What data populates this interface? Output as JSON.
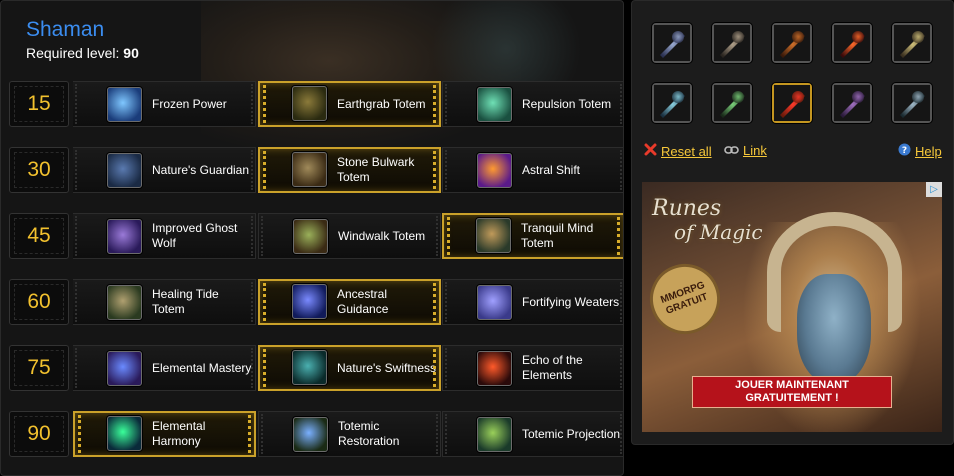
{
  "header": {
    "class_name": "Shaman",
    "required_level_label": "Required level:",
    "required_level_value": "90"
  },
  "tiers": [
    {
      "level": "15",
      "talents": [
        {
          "name": "Frozen Power",
          "icon": "frozen-power-icon",
          "selected": false,
          "colors": [
            "#7fc7ff",
            "#1a3c7a"
          ]
        },
        {
          "name": "Earthgrab Totem",
          "icon": "earthgrab-totem-icon",
          "selected": true,
          "colors": [
            "#8b7a3a",
            "#2a2a10"
          ]
        },
        {
          "name": "Repulsion Totem",
          "icon": "repulsion-totem-icon",
          "selected": false,
          "colors": [
            "#6fe0b5",
            "#1a5040"
          ]
        }
      ]
    },
    {
      "level": "30",
      "talents": [
        {
          "name": "Nature's Guardian",
          "icon": "natures-guardian-icon",
          "selected": false,
          "colors": [
            "#5a7ab0",
            "#1a2a44"
          ]
        },
        {
          "name": "Stone Bulwark Totem",
          "icon": "stone-bulwark-totem-icon",
          "selected": true,
          "colors": [
            "#a08a5a",
            "#3a2a14"
          ]
        },
        {
          "name": "Astral Shift",
          "icon": "astral-shift-icon",
          "selected": false,
          "colors": [
            "#ff9a30",
            "#5a1a8a"
          ]
        }
      ]
    },
    {
      "level": "45",
      "talents": [
        {
          "name": "Improved Ghost Wolf",
          "icon": "improved-ghost-wolf-icon",
          "selected": false,
          "colors": [
            "#9a7ad8",
            "#2a1a5a"
          ]
        },
        {
          "name": "Windwalk Totem",
          "icon": "windwalk-totem-icon",
          "selected": false,
          "colors": [
            "#9ab05a",
            "#3a2a14"
          ]
        },
        {
          "name": "Tranquil Mind Totem",
          "icon": "tranquil-mind-totem-icon",
          "selected": true,
          "colors": [
            "#c09a5a",
            "#2a3a2a"
          ]
        }
      ]
    },
    {
      "level": "60",
      "talents": [
        {
          "name": "Healing Tide Totem",
          "icon": "healing-tide-totem-icon",
          "selected": false,
          "colors": [
            "#b0a070",
            "#2a3a20"
          ]
        },
        {
          "name": "Ancestral Guidance",
          "icon": "ancestral-guidance-icon",
          "selected": true,
          "colors": [
            "#7a8aff",
            "#101a5a"
          ]
        },
        {
          "name": "Fortifying Weaters",
          "icon": "fortifying-weaters-icon",
          "selected": false,
          "colors": [
            "#a0a0ff",
            "#3a3a8a"
          ]
        }
      ]
    },
    {
      "level": "75",
      "talents": [
        {
          "name": "Elemental Mastery",
          "icon": "elemental-mastery-icon",
          "selected": false,
          "colors": [
            "#6a8aff",
            "#2a1a5a"
          ]
        },
        {
          "name": "Nature's Swiftness",
          "icon": "natures-swiftness-icon",
          "selected": true,
          "colors": [
            "#4ab0b0",
            "#0a2a2a"
          ]
        },
        {
          "name": "Echo of the Elements",
          "icon": "echo-of-the-elements-icon",
          "selected": false,
          "colors": [
            "#ff5a2a",
            "#2a0a0a"
          ]
        }
      ]
    },
    {
      "level": "90",
      "talents": [
        {
          "name": "Elemental Harmony",
          "icon": "elemental-harmony-icon",
          "selected": true,
          "colors": [
            "#3aff9a",
            "#0a2a3a"
          ]
        },
        {
          "name": "Totemic Restoration",
          "icon": "totemic-restoration-icon",
          "selected": false,
          "colors": [
            "#7ab0ff",
            "#1a2a14"
          ]
        },
        {
          "name": "Totemic Projection",
          "icon": "totemic-projection-icon",
          "selected": false,
          "colors": [
            "#9ad05a",
            "#1a3a2a"
          ]
        }
      ]
    }
  ],
  "glyphs": [
    {
      "icon": "glyph-mace-icon",
      "active": false,
      "colors": [
        "#9aaad0",
        "#2a3050"
      ]
    },
    {
      "icon": "glyph-claw-icon",
      "active": false,
      "colors": [
        "#b0a08a",
        "#2a2520"
      ]
    },
    {
      "icon": "glyph-bow-icon",
      "active": false,
      "colors": [
        "#d0702a",
        "#3a1a0a"
      ]
    },
    {
      "icon": "glyph-fire-arrow-icon",
      "active": false,
      "colors": [
        "#ff6a2a",
        "#3a0a0a"
      ]
    },
    {
      "icon": "glyph-scroll-icon",
      "active": false,
      "colors": [
        "#d0c07a",
        "#3a3020"
      ]
    },
    {
      "icon": "glyph-gun-icon",
      "active": false,
      "colors": [
        "#8ad0e0",
        "#1a3040"
      ]
    },
    {
      "icon": "glyph-green-blade-icon",
      "active": false,
      "colors": [
        "#7ad07a",
        "#1a2a1a"
      ]
    },
    {
      "icon": "glyph-lightning-shield-icon",
      "active": true,
      "colors": [
        "#ff3a2a",
        "#6a1a0a"
      ]
    },
    {
      "icon": "glyph-tentacle-icon",
      "active": false,
      "colors": [
        "#a070c0",
        "#2a1a3a"
      ]
    },
    {
      "icon": "glyph-sword-icon",
      "active": false,
      "colors": [
        "#a0b8c8",
        "#1a2a30"
      ]
    }
  ],
  "actions": {
    "reset_all": "Reset all",
    "link": "Link",
    "help": "Help"
  },
  "ad": {
    "logo_line1": "Runes",
    "logo_line2": "of Magic",
    "badge_line1": "MMORPG",
    "badge_line2": "GRATUIT",
    "cta_line1": "JOUER MAINTENANT",
    "cta_line2": "GRATUITEMENT !"
  },
  "colors": {
    "accent_gold": "#f2c12e",
    "class_blue": "#3b8df0",
    "link_gold": "#f7c83a",
    "selected_border": "#caa12a"
  }
}
